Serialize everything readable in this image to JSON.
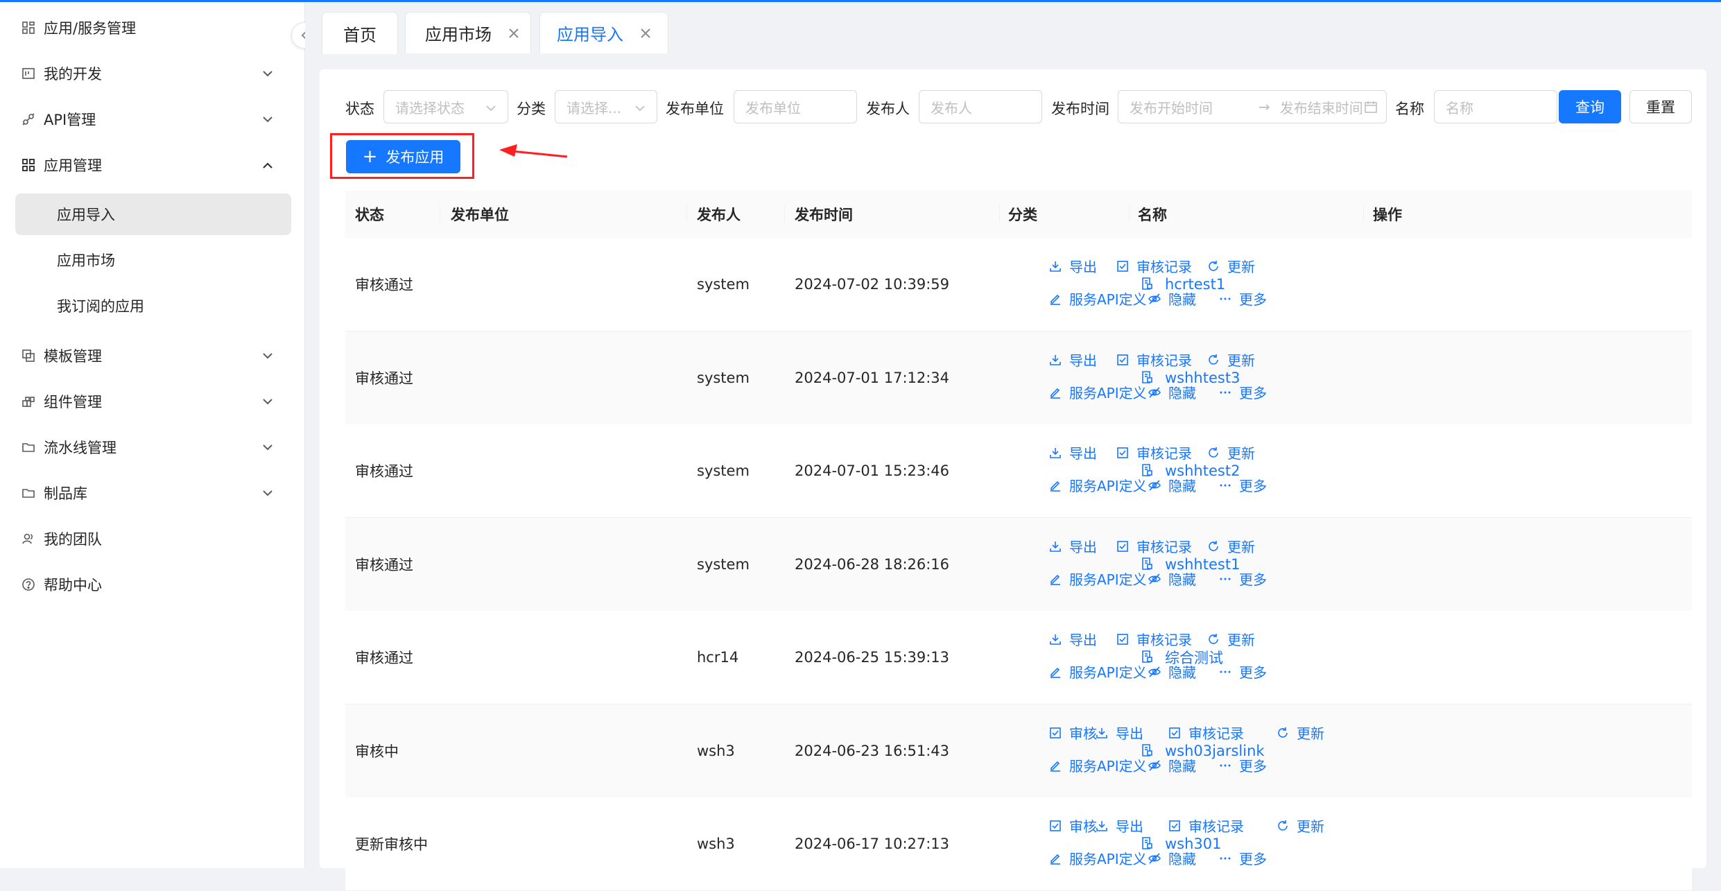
{
  "sidebar": {
    "items": [
      {
        "label": "应用/服务管理",
        "icon": "app-service-icon",
        "expanded": null
      },
      {
        "label": "我的开发",
        "icon": "dev-board-icon",
        "expanded": false
      },
      {
        "label": "API管理",
        "icon": "api-link-icon",
        "expanded": false
      },
      {
        "label": "应用管理",
        "icon": "grid-app-icon",
        "expanded": true
      },
      {
        "label": "模板管理",
        "icon": "template-icon",
        "expanded": false
      },
      {
        "label": "组件管理",
        "icon": "component-icon",
        "expanded": false
      },
      {
        "label": "流水线管理",
        "icon": "folder-icon",
        "expanded": false
      },
      {
        "label": "制品库",
        "icon": "folder-icon",
        "expanded": false
      },
      {
        "label": "我的团队",
        "icon": "team-icon",
        "expanded": null
      },
      {
        "label": "帮助中心",
        "icon": "help-icon",
        "expanded": null
      }
    ],
    "subitems": [
      {
        "label": "应用导入",
        "active": true
      },
      {
        "label": "应用市场",
        "active": false
      },
      {
        "label": "我订阅的应用",
        "active": false
      }
    ]
  },
  "tabs": [
    {
      "label": "首页",
      "closable": false,
      "active": false
    },
    {
      "label": "应用市场",
      "closable": true,
      "active": false
    },
    {
      "label": "应用导入",
      "closable": true,
      "active": true
    }
  ],
  "filters": {
    "status_label": "状态",
    "status_placeholder": "请选择状态",
    "category_label": "分类",
    "category_placeholder": "请选择...",
    "unit_label": "发布单位",
    "unit_placeholder": "发布单位",
    "publisher_label": "发布人",
    "publisher_placeholder": "发布人",
    "time_label": "发布时间",
    "time_start_placeholder": "发布开始时间",
    "time_end_placeholder": "发布结束时间",
    "time_sep": "→",
    "name_label": "名称",
    "name_placeholder": "名称",
    "query_button": "查询",
    "reset_button": "重置"
  },
  "publish_button": {
    "icon": "+",
    "label": "发布应用"
  },
  "table": {
    "columns": [
      "状态",
      "发布单位",
      "发布人",
      "发布时间",
      "分类",
      "名称",
      "操作"
    ],
    "rows": [
      {
        "status": "审核通过",
        "unit": "",
        "publisher": "system",
        "time": "2024-07-02 10:39:59",
        "category": "",
        "name": "hcrtest1",
        "actions_line1": [
          {
            "icon": "download-icon",
            "label": "导出"
          },
          {
            "icon": "checkbox-icon",
            "label": "审核记录"
          },
          {
            "icon": "refresh-icon",
            "label": "更新"
          }
        ],
        "actions_line2": [
          {
            "icon": "edit-icon",
            "label": "服务API定义"
          },
          {
            "icon": "eye-off-icon",
            "label": "隐藏"
          },
          {
            "icon": "ellipsis-icon",
            "label": "更多"
          }
        ]
      },
      {
        "status": "审核通过",
        "unit": "",
        "publisher": "system",
        "time": "2024-07-01 17:12:34",
        "category": "",
        "name": "wshhtest3",
        "actions_line1": [
          {
            "icon": "download-icon",
            "label": "导出"
          },
          {
            "icon": "checkbox-icon",
            "label": "审核记录"
          },
          {
            "icon": "refresh-icon",
            "label": "更新"
          }
        ],
        "actions_line2": [
          {
            "icon": "edit-icon",
            "label": "服务API定义"
          },
          {
            "icon": "eye-off-icon",
            "label": "隐藏"
          },
          {
            "icon": "ellipsis-icon",
            "label": "更多"
          }
        ]
      },
      {
        "status": "审核通过",
        "unit": "",
        "publisher": "system",
        "time": "2024-07-01 15:23:46",
        "category": "",
        "name": "wshhtest2",
        "actions_line1": [
          {
            "icon": "download-icon",
            "label": "导出"
          },
          {
            "icon": "checkbox-icon",
            "label": "审核记录"
          },
          {
            "icon": "refresh-icon",
            "label": "更新"
          }
        ],
        "actions_line2": [
          {
            "icon": "edit-icon",
            "label": "服务API定义"
          },
          {
            "icon": "eye-off-icon",
            "label": "隐藏"
          },
          {
            "icon": "ellipsis-icon",
            "label": "更多"
          }
        ]
      },
      {
        "status": "审核通过",
        "unit": "",
        "publisher": "system",
        "time": "2024-06-28 18:26:16",
        "category": "",
        "name": "wshhtest1",
        "actions_line1": [
          {
            "icon": "download-icon",
            "label": "导出"
          },
          {
            "icon": "checkbox-icon",
            "label": "审核记录"
          },
          {
            "icon": "refresh-icon",
            "label": "更新"
          }
        ],
        "actions_line2": [
          {
            "icon": "edit-icon",
            "label": "服务API定义"
          },
          {
            "icon": "eye-off-icon",
            "label": "隐藏"
          },
          {
            "icon": "ellipsis-icon",
            "label": "更多"
          }
        ]
      },
      {
        "status": "审核通过",
        "unit": "",
        "publisher": "hcr14",
        "time": "2024-06-25 15:39:13",
        "category": "",
        "name": "综合测试",
        "actions_line1": [
          {
            "icon": "download-icon",
            "label": "导出"
          },
          {
            "icon": "checkbox-icon",
            "label": "审核记录"
          },
          {
            "icon": "refresh-icon",
            "label": "更新"
          }
        ],
        "actions_line2": [
          {
            "icon": "edit-icon",
            "label": "服务API定义"
          },
          {
            "icon": "eye-off-icon",
            "label": "隐藏"
          },
          {
            "icon": "ellipsis-icon",
            "label": "更多"
          }
        ]
      },
      {
        "status": "审核中",
        "unit": "",
        "publisher": "wsh3",
        "time": "2024-06-23 16:51:43",
        "category": "",
        "name": "wsh03jarslink",
        "actions_line1": [
          {
            "icon": "checkbox-icon",
            "label": "审核"
          },
          {
            "icon": "download-icon",
            "label": "导出"
          },
          {
            "icon": "checkbox-icon",
            "label": "审核记录"
          },
          {
            "icon": "refresh-icon",
            "label": "更新"
          }
        ],
        "actions_line2": [
          {
            "icon": "edit-icon",
            "label": "服务API定义"
          },
          {
            "icon": "eye-off-icon",
            "label": "隐藏"
          },
          {
            "icon": "ellipsis-icon",
            "label": "更多"
          }
        ]
      },
      {
        "status": "更新审核中",
        "unit": "",
        "publisher": "wsh3",
        "time": "2024-06-17 10:27:13",
        "category": "",
        "name": "wsh301",
        "actions_line1": [
          {
            "icon": "checkbox-icon",
            "label": "审核"
          },
          {
            "icon": "download-icon",
            "label": "导出"
          },
          {
            "icon": "checkbox-icon",
            "label": "审核记录"
          },
          {
            "icon": "refresh-icon",
            "label": "更新"
          }
        ],
        "actions_line2": [
          {
            "icon": "edit-icon",
            "label": "服务API定义"
          },
          {
            "icon": "eye-off-icon",
            "label": "隐藏"
          },
          {
            "icon": "ellipsis-icon",
            "label": "更多"
          }
        ]
      }
    ]
  },
  "colors": {
    "accent": "#1677ff",
    "annotation": "#ff1f1f",
    "active_bg": "#e9e9e9"
  }
}
